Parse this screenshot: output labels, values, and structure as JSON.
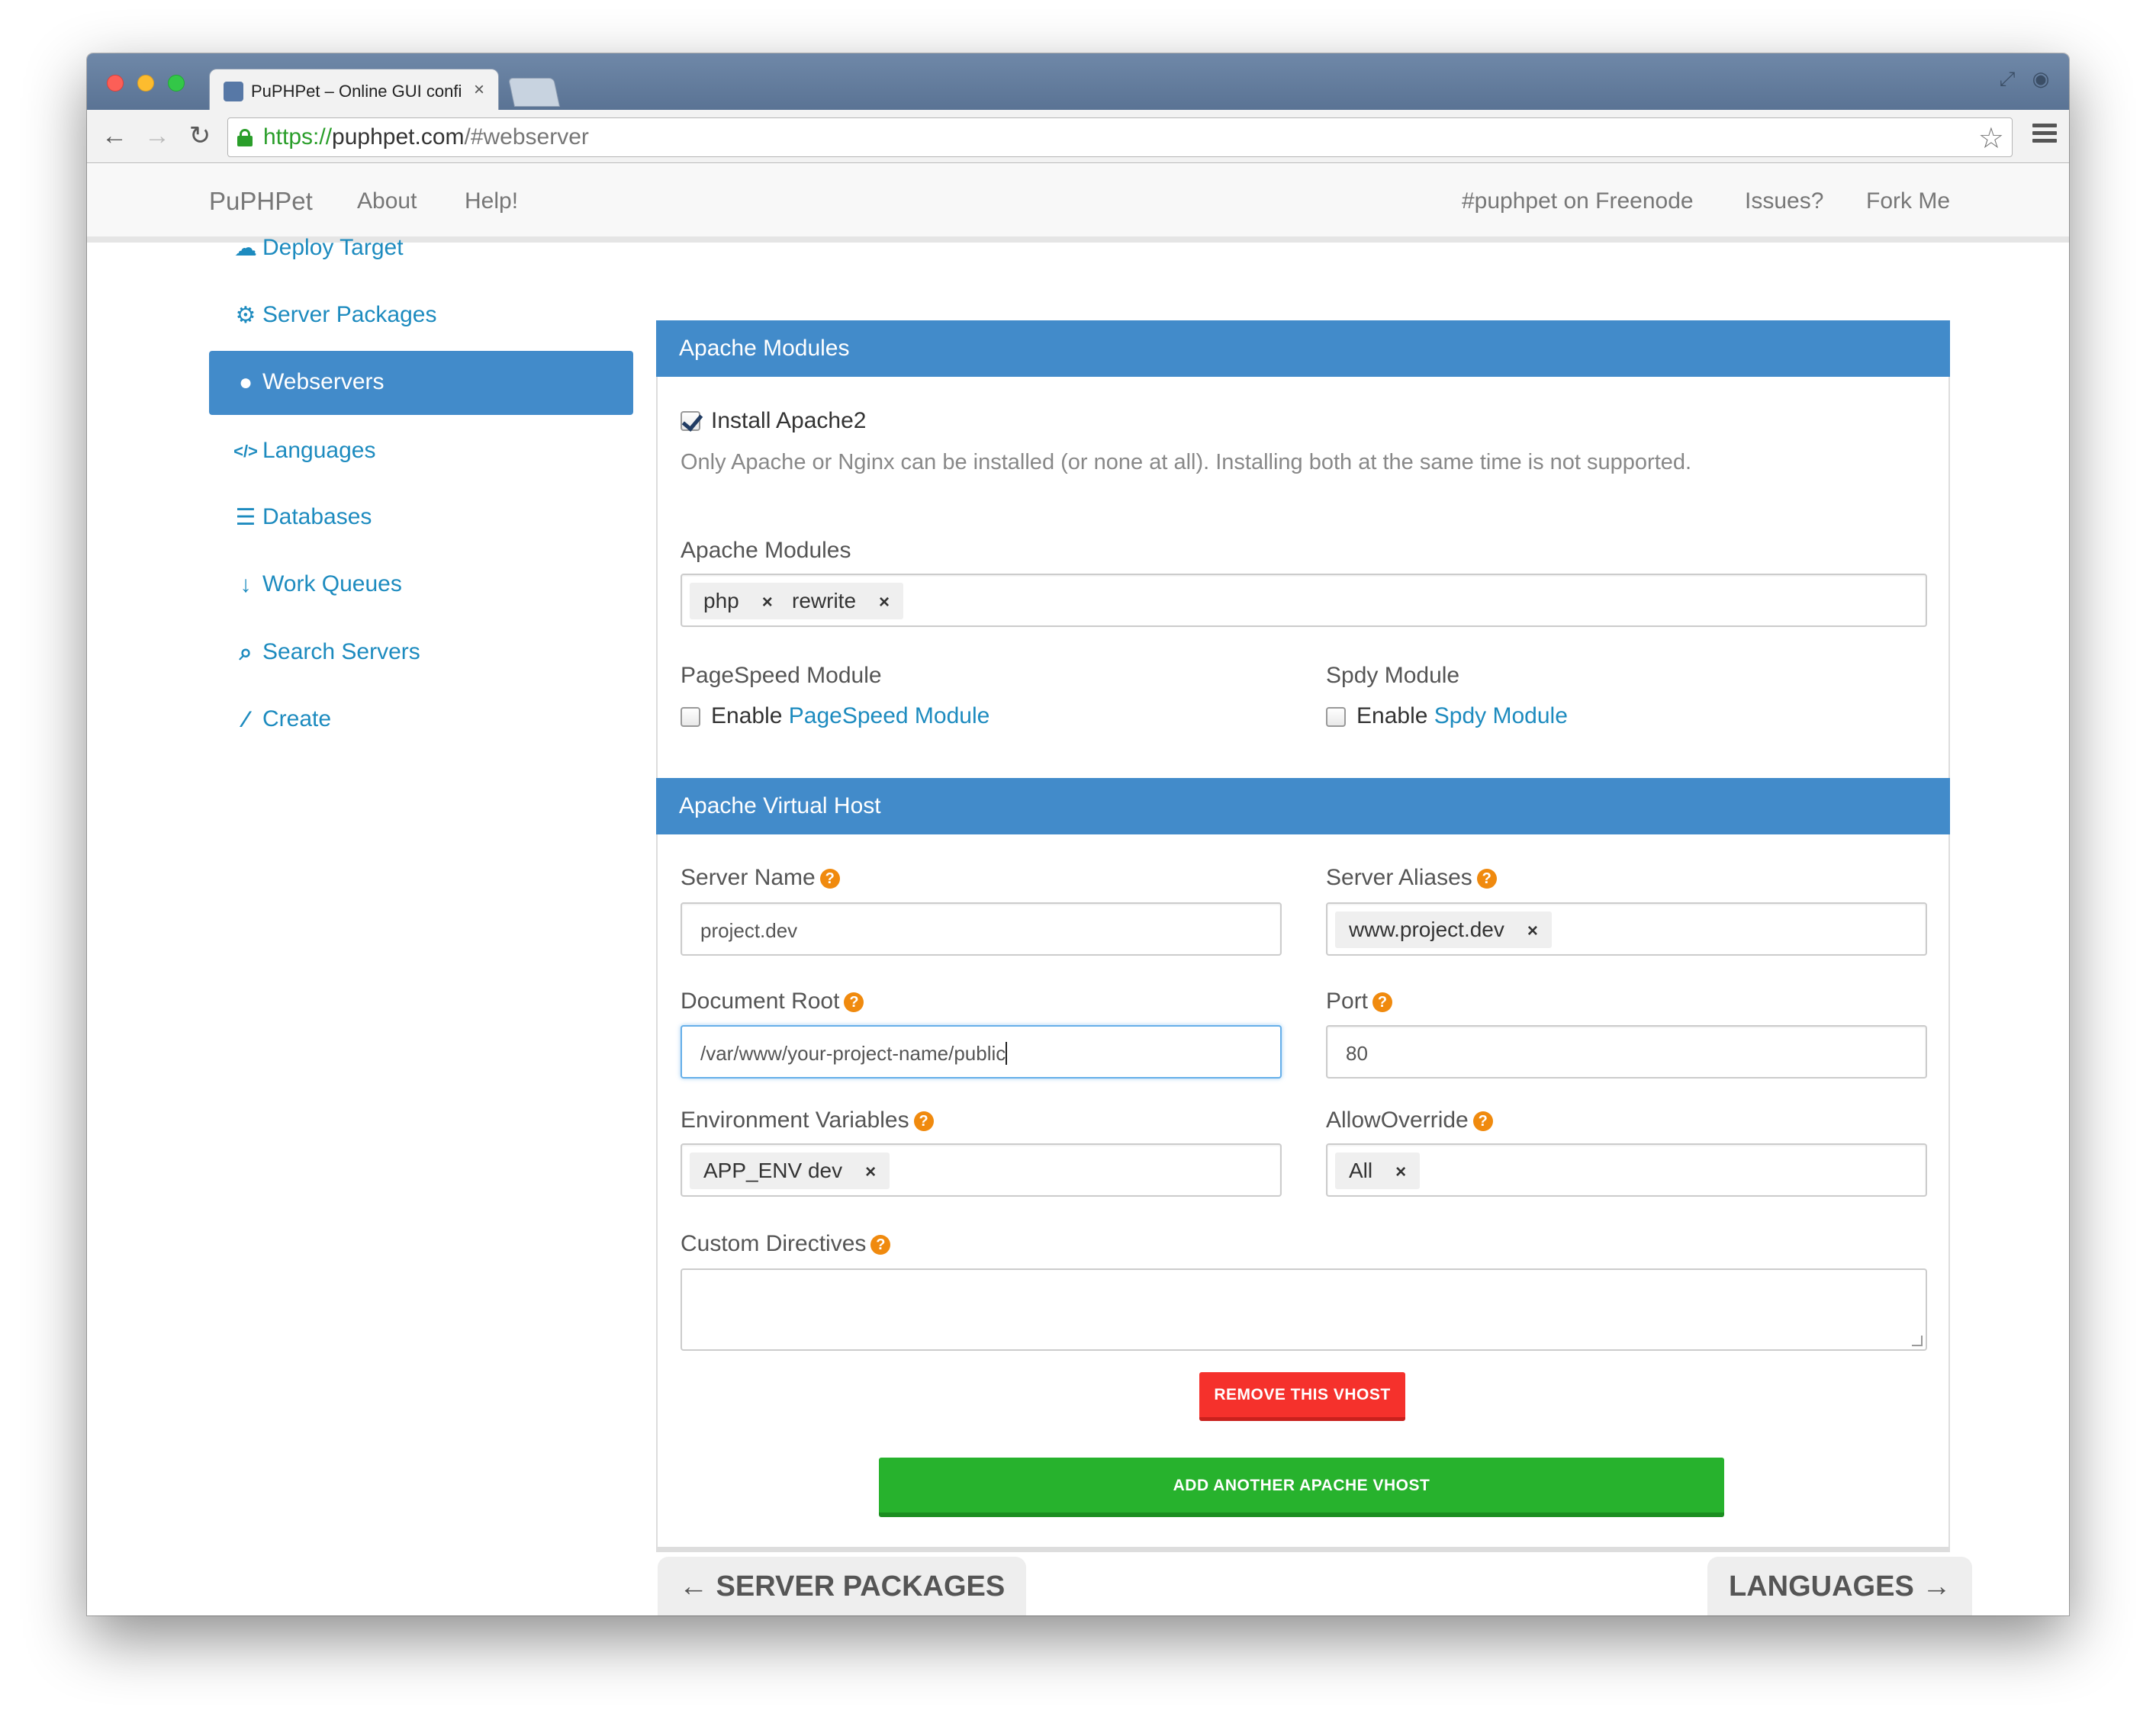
{
  "browser": {
    "tab_title": "PuPHPet – Online GUI confi",
    "tab_close": "×",
    "url_scheme": "https://",
    "url_host": "puphpet.com",
    "url_path": "/#webserver"
  },
  "navbar": {
    "brand": "PuPHPet",
    "about": "About",
    "help": "Help!",
    "freenode": "#puphpet on Freenode",
    "issues": "Issues?",
    "fork": "Fork Me"
  },
  "sidebar": {
    "items": [
      {
        "label": "Deploy Target",
        "icon": "cloud-icon",
        "glyph": "☁"
      },
      {
        "label": "Server Packages",
        "icon": "gears-icon",
        "glyph": "⚙"
      },
      {
        "label": "Webservers",
        "icon": "globe-icon",
        "glyph": "●"
      },
      {
        "label": "Languages",
        "icon": "code-icon",
        "glyph": "</>"
      },
      {
        "label": "Databases",
        "icon": "database-icon",
        "glyph": "☰"
      },
      {
        "label": "Work Queues",
        "icon": "sort-numeric-icon",
        "glyph": "↓"
      },
      {
        "label": "Search Servers",
        "icon": "search-icon",
        "glyph": "⌕"
      },
      {
        "label": "Create",
        "icon": "magic-wand-icon",
        "glyph": "⁄"
      }
    ],
    "active_index": 2
  },
  "apache_modules_panel": {
    "heading": "Apache Modules",
    "install_label": "Install Apache2",
    "install_checked": true,
    "install_hint": "Only Apache or Nginx can be installed (or none at all). Installing both at the same time is not supported.",
    "modules_label": "Apache Modules",
    "modules": [
      "php",
      "rewrite"
    ],
    "pagespeed_label": "PageSpeed Module",
    "pagespeed_enable": "Enable",
    "pagespeed_link": "PageSpeed Module",
    "pagespeed_checked": false,
    "spdy_label": "Spdy Module",
    "spdy_enable": "Enable",
    "spdy_link": "Spdy Module",
    "spdy_checked": false
  },
  "vhost_panel": {
    "heading": "Apache Virtual Host",
    "server_name_label": "Server Name",
    "server_name_value": "project.dev",
    "server_aliases_label": "Server Aliases",
    "server_aliases": [
      "www.project.dev"
    ],
    "docroot_label": "Document Root",
    "docroot_value": "/var/www/your-project-name/public",
    "port_label": "Port",
    "port_value": "80",
    "env_label": "Environment Variables",
    "env_tokens": [
      "APP_ENV dev"
    ],
    "allowoverride_label": "AllowOverride",
    "allowoverride_tokens": [
      "All"
    ],
    "custom_label": "Custom Directives",
    "custom_value": "",
    "help_glyph": "?",
    "remove_button": "REMOVE THIS VHOST",
    "add_button": "ADD ANOTHER APACHE VHOST"
  },
  "pager": {
    "prev": "← SERVER PACKAGES",
    "next": "LANGUAGES →"
  },
  "colors": {
    "accent": "#428bca",
    "link": "#1d8bbf",
    "danger": "#f5312c",
    "success": "#27b22d",
    "help": "#f08a0e"
  }
}
